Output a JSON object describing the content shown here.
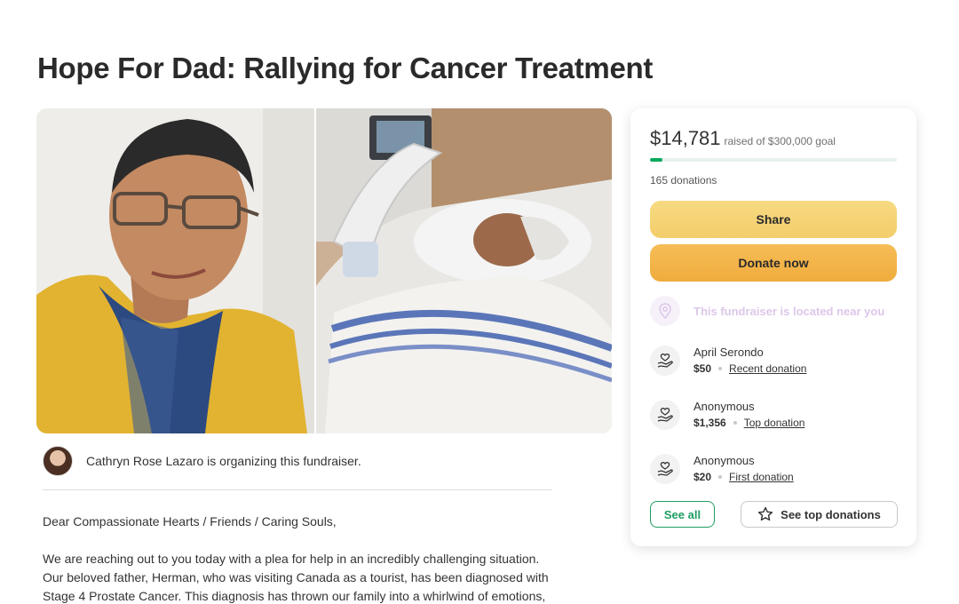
{
  "campaign": {
    "title": "Hope For Dad: Rallying for Cancer Treatment",
    "organizer_text": "Cathryn Rose Lazaro is organizing this fundraiser.",
    "story": [
      "Dear Compassionate Hearts / Friends / Caring Souls,",
      "We are reaching out to you today with a plea for help in an incredibly challenging situation. Our beloved father, Herman, who was visiting Canada as a tourist, has been diagnosed with Stage 4 Prostate Cancer. This diagnosis has thrown our family into a whirlwind of emotions,"
    ]
  },
  "card": {
    "raised_amount": "$14,781",
    "raised_goal": "raised of $300,000 goal",
    "progress_percent": 4.9,
    "donations_count": "165 donations",
    "share_label": "Share",
    "donate_label": "Donate now",
    "near_text": "This fundraiser is located near you",
    "donors": [
      {
        "name": "April Serondo",
        "amount": "$50",
        "tag": "Recent donation"
      },
      {
        "name": "Anonymous",
        "amount": "$1,356",
        "tag": "Top donation"
      },
      {
        "name": "Anonymous",
        "amount": "$20",
        "tag": "First donation"
      }
    ],
    "see_all_label": "See all",
    "see_top_label": "See top donations"
  },
  "colors": {
    "brand_green": "#02a95c",
    "share_yellow": "#f3cd6b",
    "donate_orange": "#f0ac3d"
  },
  "icons": {
    "donor": "heart-hand-icon",
    "location": "location-pin-icon",
    "star": "star-outline-icon"
  }
}
